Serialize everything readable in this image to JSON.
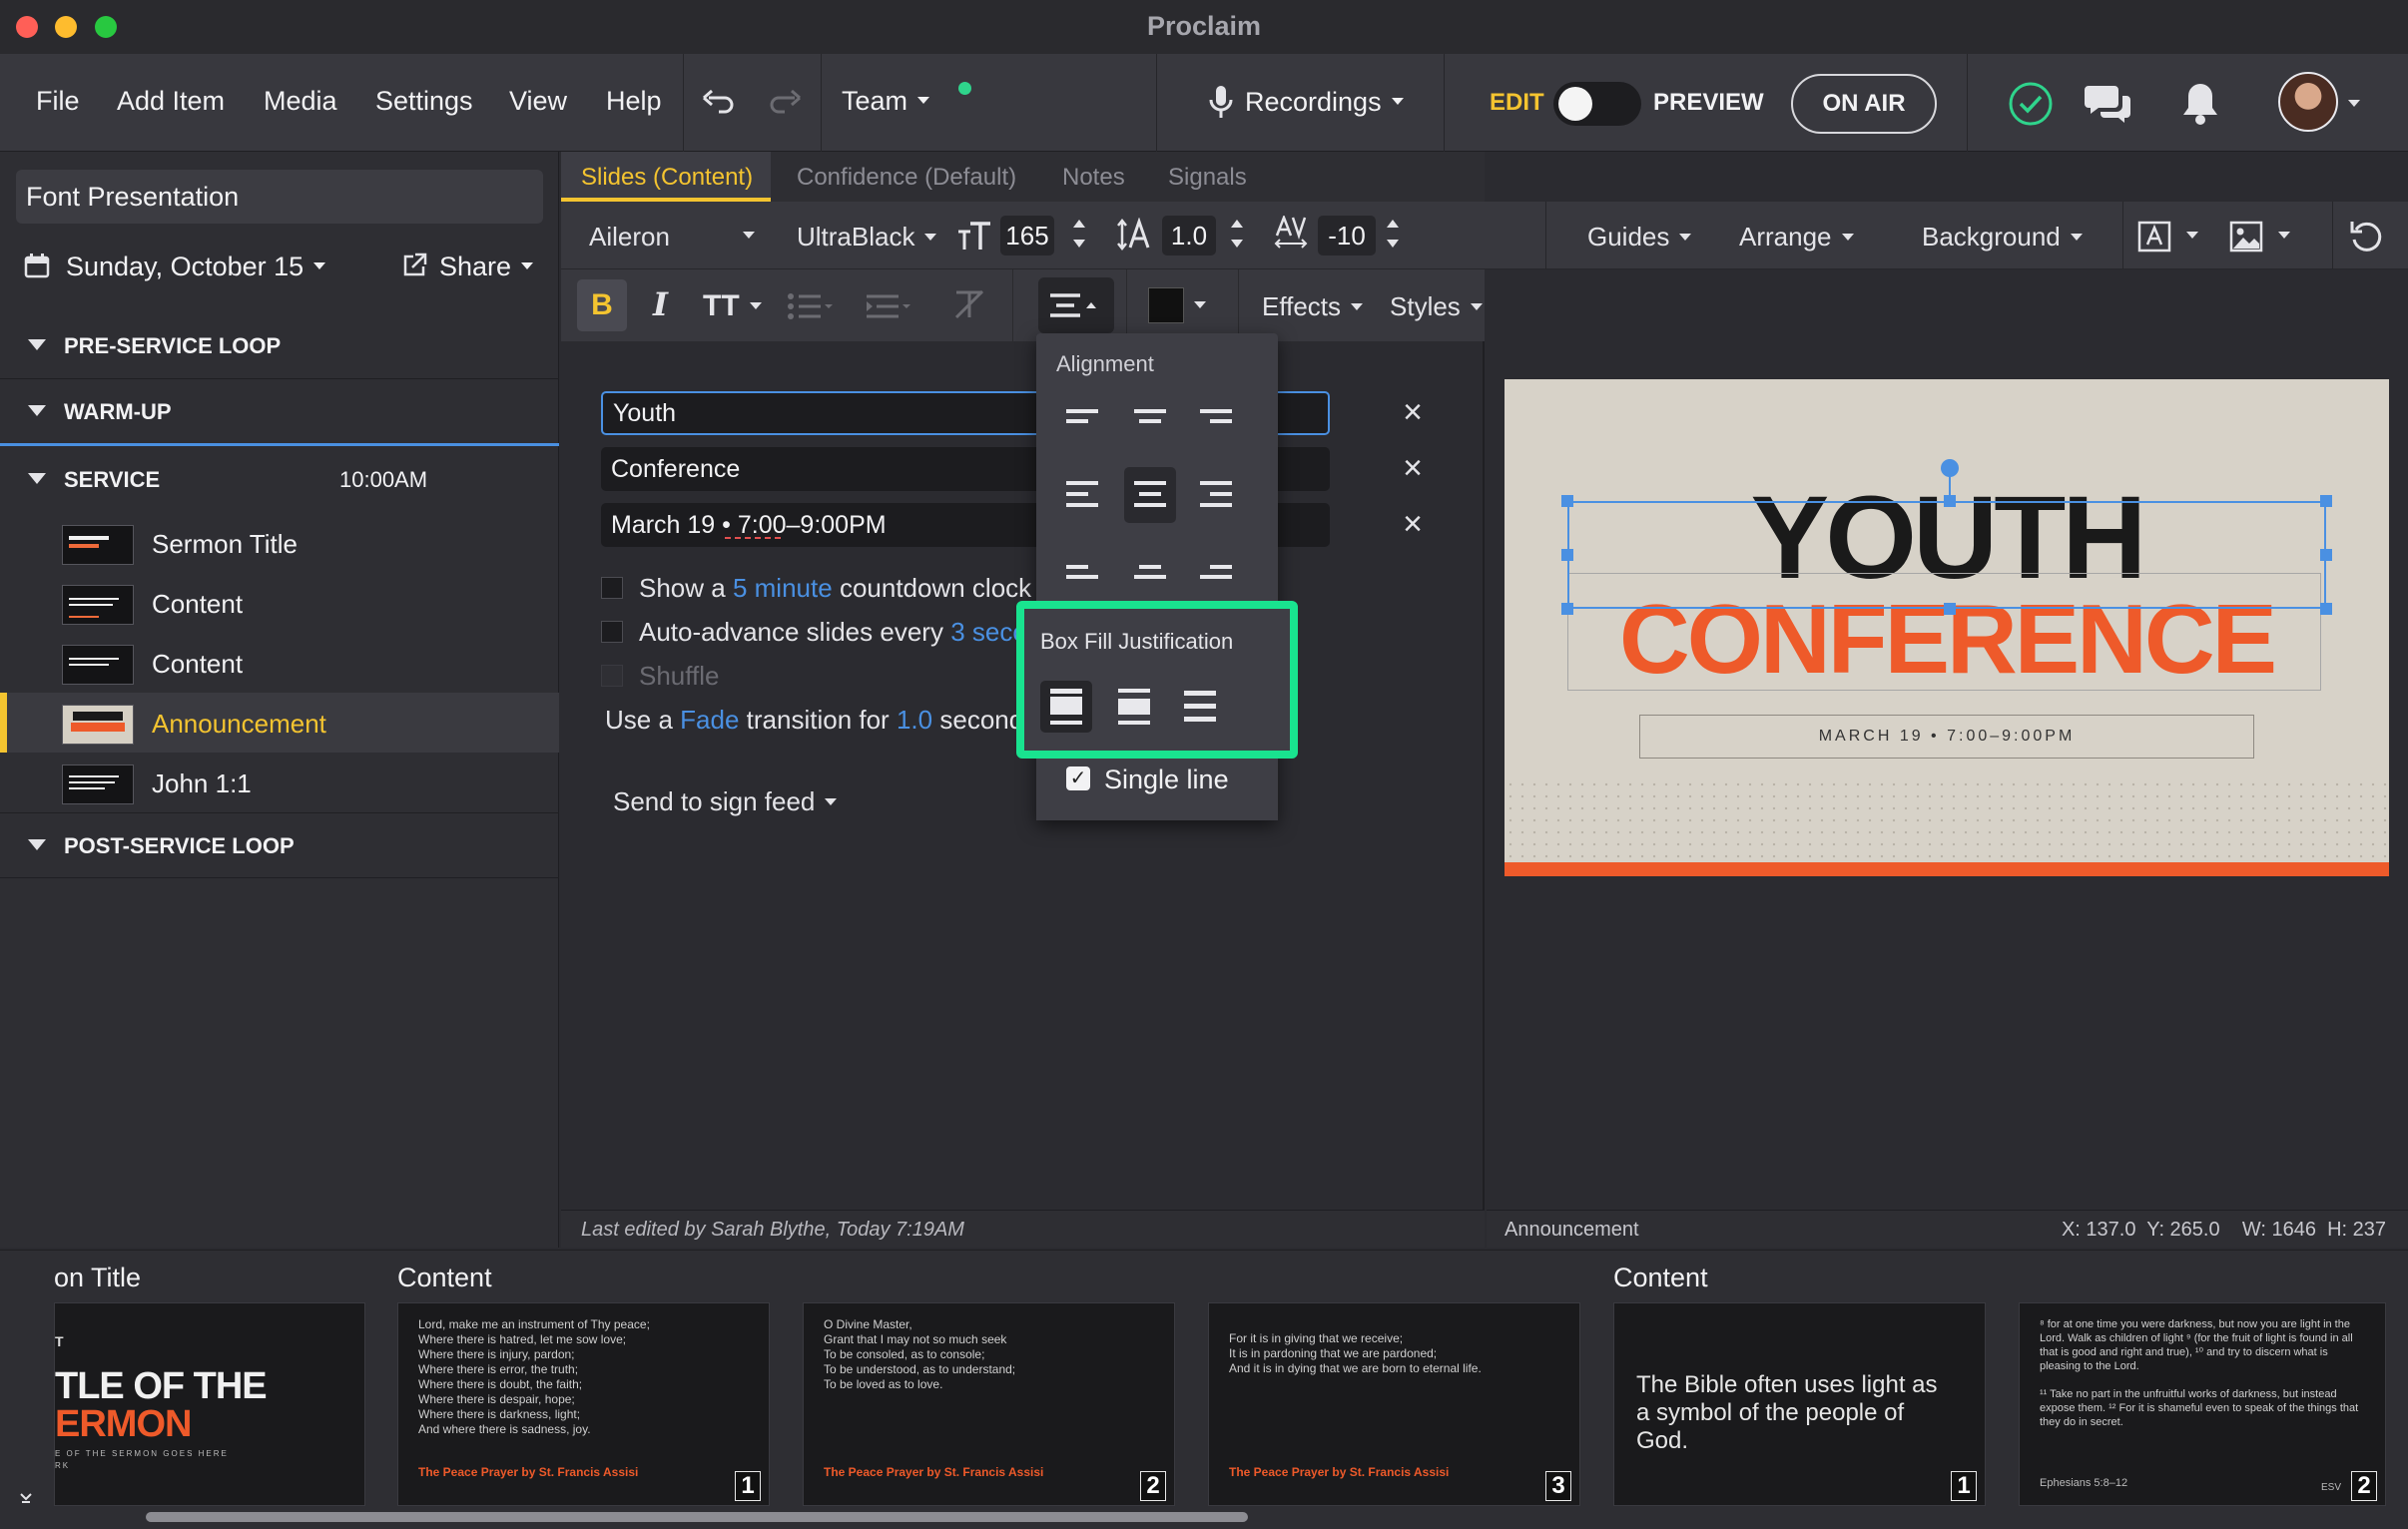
{
  "window": {
    "title": "Proclaim"
  },
  "menu": {
    "file": "File",
    "add_item": "Add Item",
    "media": "Media",
    "settings": "Settings",
    "view": "View",
    "help": "Help",
    "team": "Team",
    "recordings": "Recordings",
    "edit": "EDIT",
    "preview": "PREVIEW",
    "on_air": "ON AIR"
  },
  "sidebar": {
    "presentation_name": "Font Presentation",
    "date": "Sunday, October 15",
    "share": "Share",
    "sections": {
      "pre_service": "PRE-SERVICE LOOP",
      "warm_up": "WARM-UP",
      "service": "SERVICE",
      "service_time": "10:00AM",
      "post_service": "POST-SERVICE LOOP"
    },
    "items": [
      {
        "label": "Sermon Title"
      },
      {
        "label": "Content"
      },
      {
        "label": "Content"
      },
      {
        "label": "Announcement",
        "active": true
      },
      {
        "label": "John 1:1"
      }
    ]
  },
  "tabs": {
    "slides": "Slides (Content)",
    "confidence": "Confidence (Default)",
    "notes": "Notes",
    "signals": "Signals"
  },
  "toolbar": {
    "font": "Aileron",
    "weight": "UltraBlack",
    "size": "165",
    "line_height": "1.0",
    "tracking": "-10",
    "guides": "Guides",
    "arrange": "Arrange",
    "background": "Background",
    "bold": "B",
    "italic": "I",
    "text_case": "TT",
    "effects": "Effects",
    "styles": "Styles"
  },
  "editor": {
    "fields": [
      "Youth",
      "Conference",
      "March 19 • 7:00–9:00PM"
    ],
    "countdown": {
      "pre": "Show a",
      "link": "5 minute",
      "post": "countdown clock"
    },
    "autoadvance": {
      "pre": "Auto-advance slides every",
      "link": "3 seco"
    },
    "shuffle": "Shuffle",
    "transition": {
      "pre": "Use a",
      "fade": "Fade",
      "mid": "transition for",
      "dur": "1.0",
      "post": "second"
    },
    "send_feed": "Send to sign feed",
    "last_edited": "Last edited by Sarah Blythe, Today 7:19AM"
  },
  "popup": {
    "alignment_title": "Alignment",
    "box_fill_title": "Box Fill Justification",
    "single_line": "Single line"
  },
  "preview": {
    "title": "YOUTH",
    "subtitle": "CONFERENCE",
    "date_line": "MARCH 19  •  7:00–9:00PM",
    "item_name": "Announcement",
    "coords": "X: 137.0  Y: 265.0    W: 1646  H: 237"
  },
  "filmstrip": {
    "groups": [
      "on Title",
      "Content",
      "Content"
    ],
    "cards": [
      {
        "kind": "title",
        "l1": "T",
        "l2": "TLE OF THE",
        "l3": "ERMON",
        "l4": "E OF THE SERMON GOES HERE",
        "l5": "RK"
      },
      {
        "kind": "text",
        "body": "Lord, make me an instrument of Thy peace;\nWhere there is hatred, let me sow love;\nWhere there is injury, pardon;\nWhere there is error, the truth;\nWhere there is doubt, the faith;\nWhere there is despair, hope;\nWhere there is darkness, light;\nAnd where there is sadness, joy.",
        "src": "The Peace Prayer by St. Francis Assisi",
        "num": "1"
      },
      {
        "kind": "text",
        "body": "O Divine Master,\nGrant that I may not so much seek\nTo be consoled, as to console;\nTo be understood, as to understand;\nTo be loved as to love.",
        "src": "The Peace Prayer by St. Francis Assisi",
        "num": "2"
      },
      {
        "kind": "text",
        "body": "For it is in giving that we receive;\nIt is in pardoning that we are pardoned;\nAnd it is in dying that we are born to eternal life.",
        "src": "The Peace Prayer by St. Francis Assisi",
        "num": "3"
      },
      {
        "kind": "big",
        "body": "The Bible often uses light as a symbol of the people of God.",
        "num": "1"
      },
      {
        "kind": "verse",
        "body": "⁸ for at one time you were darkness, but now you are light in the Lord. Walk as children of light ⁹ (for the fruit of light is found in all that is good and right and true), ¹⁰ and try to discern what is pleasing to the Lord.\n\n¹¹ Take no part in the unfruitful works of darkness, but instead expose them. ¹² For it is shameful even to speak of the things that they do in secret.",
        "ref": "Ephesians 5:8–12",
        "ver": "ESV",
        "num": "2"
      }
    ]
  },
  "colors": {
    "accent": "#f4c430",
    "highlight": "#19e38f",
    "brand_orange": "#ee5a2a",
    "link": "#4a90e2"
  }
}
